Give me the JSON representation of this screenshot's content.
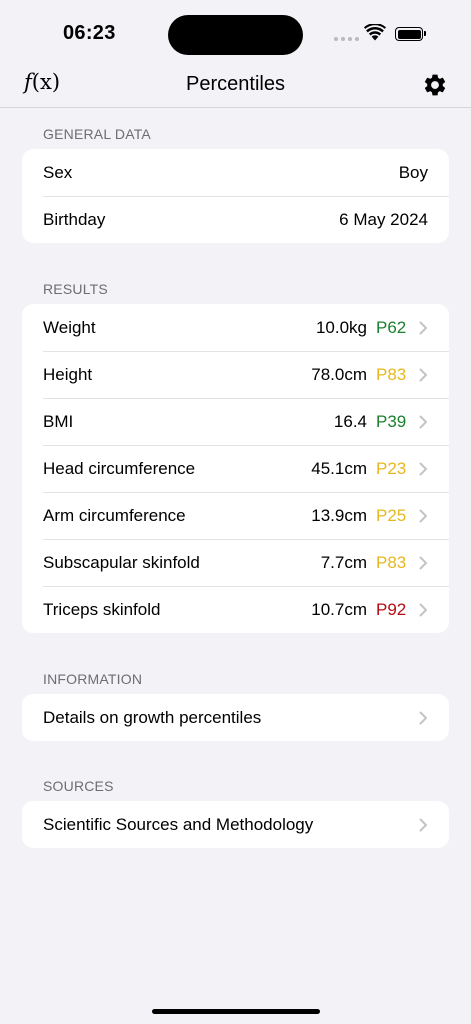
{
  "status": {
    "time": "06:23"
  },
  "nav": {
    "fx": "f",
    "fx_arg": "(x)",
    "title": "Percentiles"
  },
  "general": {
    "header": "General Data",
    "sex_label": "Sex",
    "sex_value": "Boy",
    "birthday_label": "Birthday",
    "birthday_value": "6 May 2024"
  },
  "results": {
    "header": "Results",
    "items": [
      {
        "label": "Weight",
        "value": "10.0kg",
        "percentile": "P62",
        "color": "#1a7f2e"
      },
      {
        "label": "Height",
        "value": "78.0cm",
        "percentile": "P83",
        "color": "#e6b820"
      },
      {
        "label": "BMI",
        "value": "16.4",
        "percentile": "P39",
        "color": "#1a7f2e"
      },
      {
        "label": "Head circumference",
        "value": "45.1cm",
        "percentile": "P23",
        "color": "#e6b820"
      },
      {
        "label": "Arm circumference",
        "value": "13.9cm",
        "percentile": "P25",
        "color": "#e6b820"
      },
      {
        "label": "Subscapular skinfold",
        "value": "7.7cm",
        "percentile": "P83",
        "color": "#e6b820"
      },
      {
        "label": "Triceps skinfold",
        "value": "10.7cm",
        "percentile": "P92",
        "color": "#b40d13"
      }
    ]
  },
  "information": {
    "header": "Information",
    "item": "Details on growth percentiles"
  },
  "sources": {
    "header": "Sources",
    "item": "Scientific Sources and Methodology"
  }
}
